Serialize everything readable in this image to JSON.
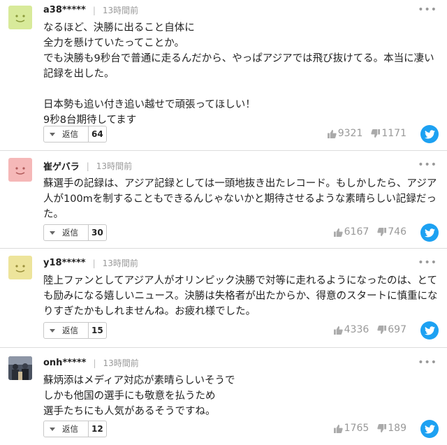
{
  "ui": {
    "reply_label": "返信",
    "more_glyph": "•••",
    "separator": "|",
    "colors": {
      "twitter": "#1da1f2",
      "avatar_green": "#d8ea9a",
      "avatar_pink": "#f5b8b8",
      "avatar_yellow": "#ede49b"
    }
  },
  "comments": [
    {
      "username": "a38*****",
      "time": "13時間前",
      "avatar_type": "smiley",
      "lines": [
        "なるほど、決勝に出ること自体に",
        "全力を懸けていたってことか。",
        "でも決勝も9秒台で普通に走るんだから、やっぱアジアでは飛び抜けてる。本当に凄い",
        "記録を出した。",
        "",
        "日本勢も追い付き追い越せで頑張ってほしい！",
        "9秒8台期待してます"
      ],
      "reply_count": "64",
      "likes": "9321",
      "dislikes": "1171"
    },
    {
      "username": "崔ゲバラ",
      "time": "13時間前",
      "avatar_type": "smiley",
      "lines": [
        "蘇選手の記録は、アジア記録としては一頭地抜き出たレコード。もしかしたら、アジア",
        "人が100mを制することもできるんじゃないかと期待させるような素晴らしい記録だっ",
        "た。"
      ],
      "reply_count": "30",
      "likes": "6167",
      "dislikes": "746"
    },
    {
      "username": "y18*****",
      "time": "13時間前",
      "avatar_type": "smiley",
      "lines": [
        "陸上ファンとしてアジア人がオリンピック決勝で対等に走れるようになったのは、とて",
        "も励みになる嬉しいニュース。決勝は失格者が出たからか、得意のスタートに慎重にな",
        "りすぎたかもしれませんね。お疲れ様でした。"
      ],
      "reply_count": "15",
      "likes": "4336",
      "dislikes": "697"
    },
    {
      "username": "onh*****",
      "time": "13時間前",
      "avatar_type": "photo",
      "lines": [
        "蘇炳添はメディア対応が素晴らしいそうで",
        "しかも他国の選手にも敬意を払うため",
        "選手たちにも人気があるそうですね。"
      ],
      "reply_count": "12",
      "likes": "1765",
      "dislikes": "189"
    }
  ]
}
